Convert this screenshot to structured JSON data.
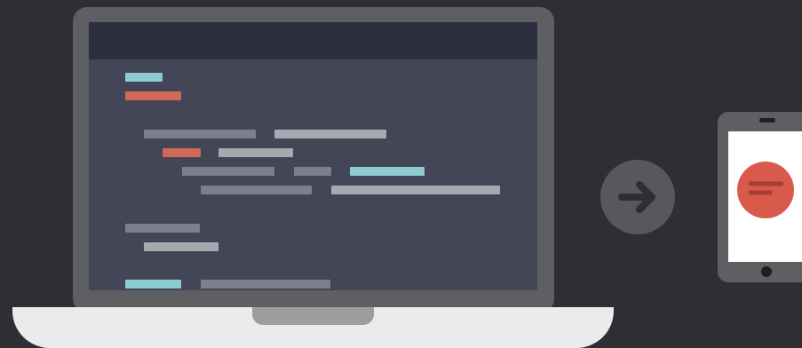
{
  "colors": {
    "background": "#2f2f33",
    "device_frame": "#5f5f63",
    "screen": "#424656",
    "screen_header": "#2b2f40",
    "code_teal": "#8ecbd1",
    "code_red": "#d06a56",
    "code_gray": "#7d7f8c",
    "code_light": "#a7a9b0",
    "laptop_base": "#ebebeb",
    "laptop_notch": "#9d9d9d",
    "arrow_circle": "#58585c",
    "arrow": "#2f2f33",
    "app_icon": "#d75a4a",
    "phone_screen": "#ffffff"
  },
  "icons": {
    "arrow": "arrow-right-icon",
    "app": "lines-icon"
  }
}
